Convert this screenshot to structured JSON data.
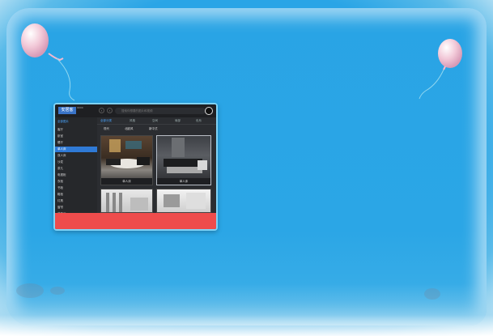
{
  "app": {
    "logo_text": "安居客",
    "logo_sub": "9000",
    "search_placeholder": "搜索你想要的图片和视频",
    "back_icon": "chevron-left-icon",
    "forward_icon": "chevron-right-icon"
  },
  "sidebar": {
    "header": "全部图片",
    "items": [
      {
        "label": "客厅",
        "count": "",
        "head": true
      },
      {
        "label": "卧室",
        "count": "",
        "head": false
      },
      {
        "label": "餐厅",
        "count": "",
        "head": false
      },
      {
        "label": "单人床",
        "count": "",
        "active": true
      },
      {
        "label": "双人床",
        "count": ""
      },
      {
        "label": "沙发",
        "count": ""
      },
      {
        "label": "茶几",
        "count": ""
      },
      {
        "label": "电视柜",
        "count": ""
      },
      {
        "label": "衣柜",
        "count": ""
      },
      {
        "label": "书柜",
        "count": ""
      },
      {
        "label": "鞋柜",
        "count": ""
      },
      {
        "label": "灯具",
        "count": ""
      },
      {
        "label": "窗帘",
        "count": ""
      },
      {
        "label": "装饰画",
        "count": ""
      }
    ]
  },
  "tabs": [
    {
      "label": "全部分类",
      "active": true
    },
    {
      "label": "风格",
      "active": false
    },
    {
      "label": "空间",
      "active": false
    },
    {
      "label": "局部",
      "active": false
    },
    {
      "label": "色系",
      "active": false
    }
  ],
  "subtabs": [
    "现代",
    "北欧风",
    "新中式"
  ],
  "thumbs": [
    {
      "caption": "单人床",
      "selected": false
    },
    {
      "caption": "单人床",
      "selected": true
    },
    {
      "caption": "",
      "selected": false
    },
    {
      "caption": "",
      "selected": false
    }
  ],
  "colors": {
    "background": "#2aa5e6",
    "panel_border": "#7fd3f7",
    "accent": "#2f7ad6",
    "cta_bar": "#ee4c4c"
  }
}
